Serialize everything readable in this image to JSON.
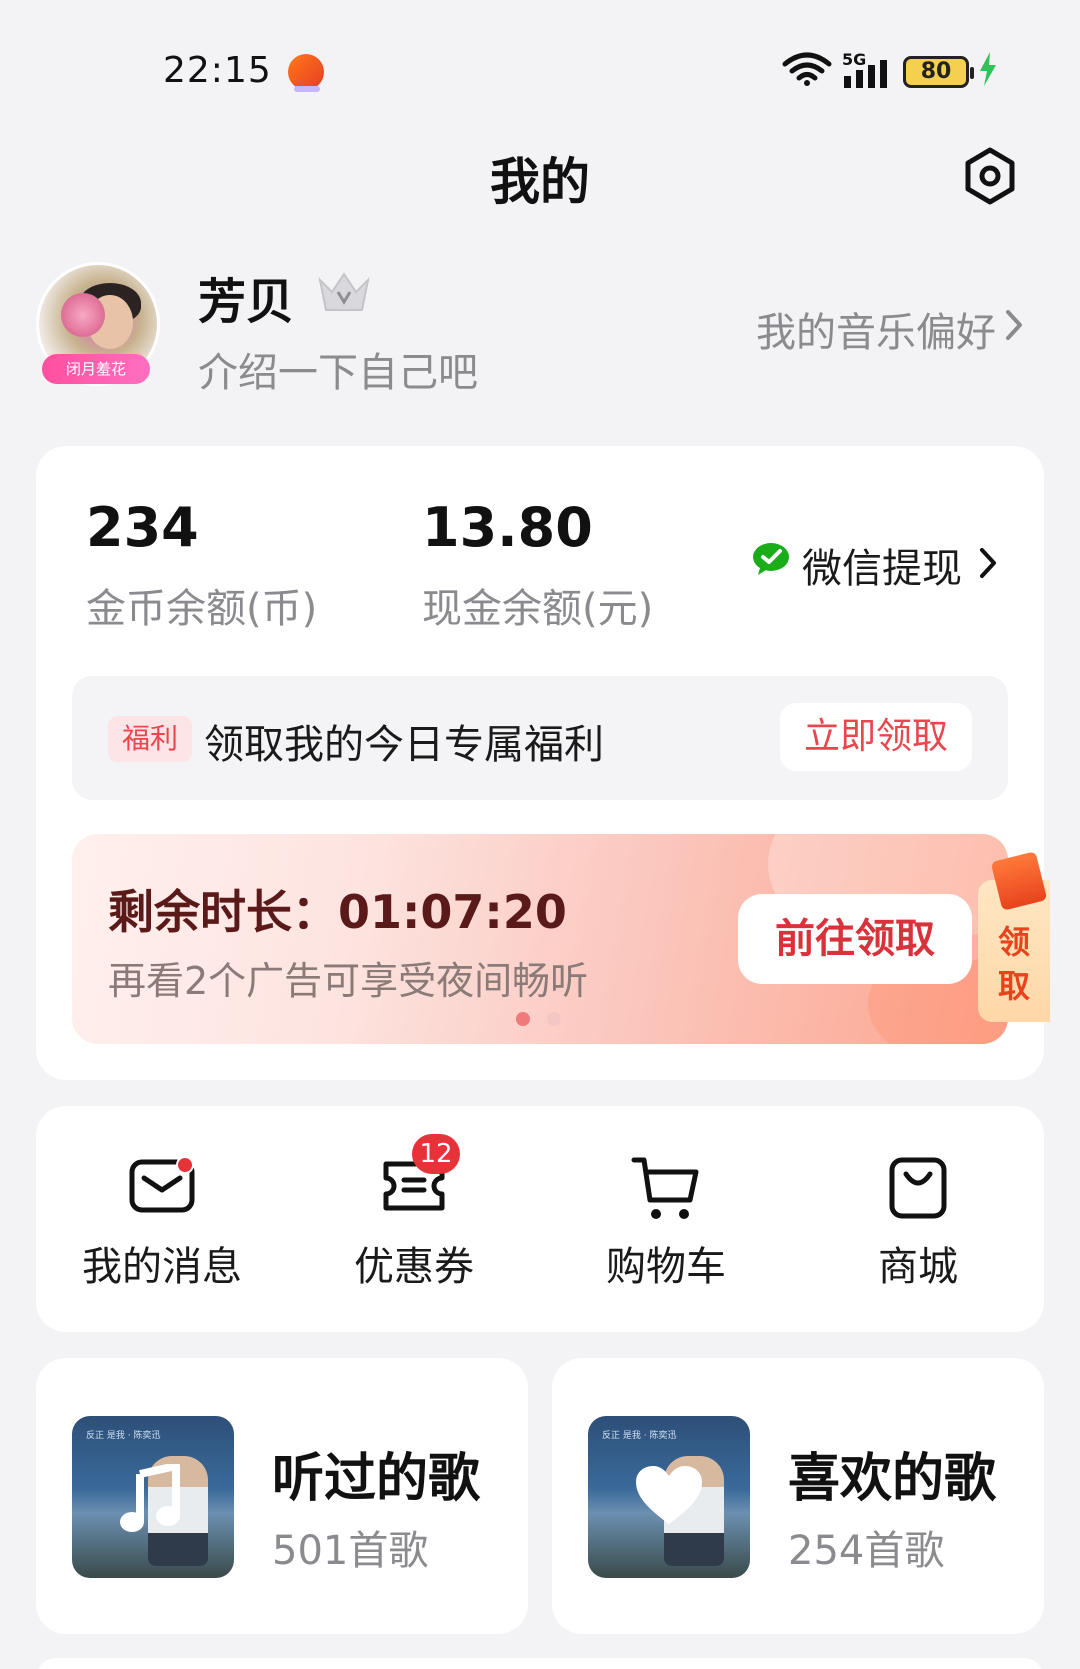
{
  "status_bar": {
    "time": "22:15",
    "network": "5G",
    "battery": "80"
  },
  "header": {
    "title": "我的"
  },
  "profile": {
    "avatar_tag": "闭月羞花",
    "username": "芳贝",
    "bio": "介绍一下自己吧",
    "music_preference": "我的音乐偏好"
  },
  "wallet": {
    "coin_value": "234",
    "coin_label": "金币余额(币)",
    "cash_value": "13.80",
    "cash_label": "现金余额(元)",
    "wechat_withdraw": "微信提现"
  },
  "welfare": {
    "tag": "福利",
    "text": "领取我的今日专属福利",
    "button": "立即领取"
  },
  "ad_banner": {
    "title": "剩余时长：01:07:20",
    "subtitle": "再看2个广告可享受夜间畅听",
    "button": "前往领取",
    "side_label": "领取",
    "carousel_active": 1,
    "carousel_total": 2
  },
  "quick_actions": [
    {
      "label": "我的消息",
      "icon": "mail-icon",
      "has_dot": true
    },
    {
      "label": "优惠券",
      "icon": "coupon-icon",
      "badge": "12"
    },
    {
      "label": "购物车",
      "icon": "cart-icon"
    },
    {
      "label": "商城",
      "icon": "shopping-bag-icon"
    }
  ],
  "song_lists": [
    {
      "title": "听过的歌",
      "count": "501首歌",
      "icon": "music-note-icon"
    },
    {
      "title": "喜欢的歌",
      "count": "254首歌",
      "icon": "heart-icon"
    }
  ],
  "colors": {
    "accent_red": "#e8323a",
    "page_bg": "#f3f3f5",
    "wechat_green": "#1aad19"
  }
}
